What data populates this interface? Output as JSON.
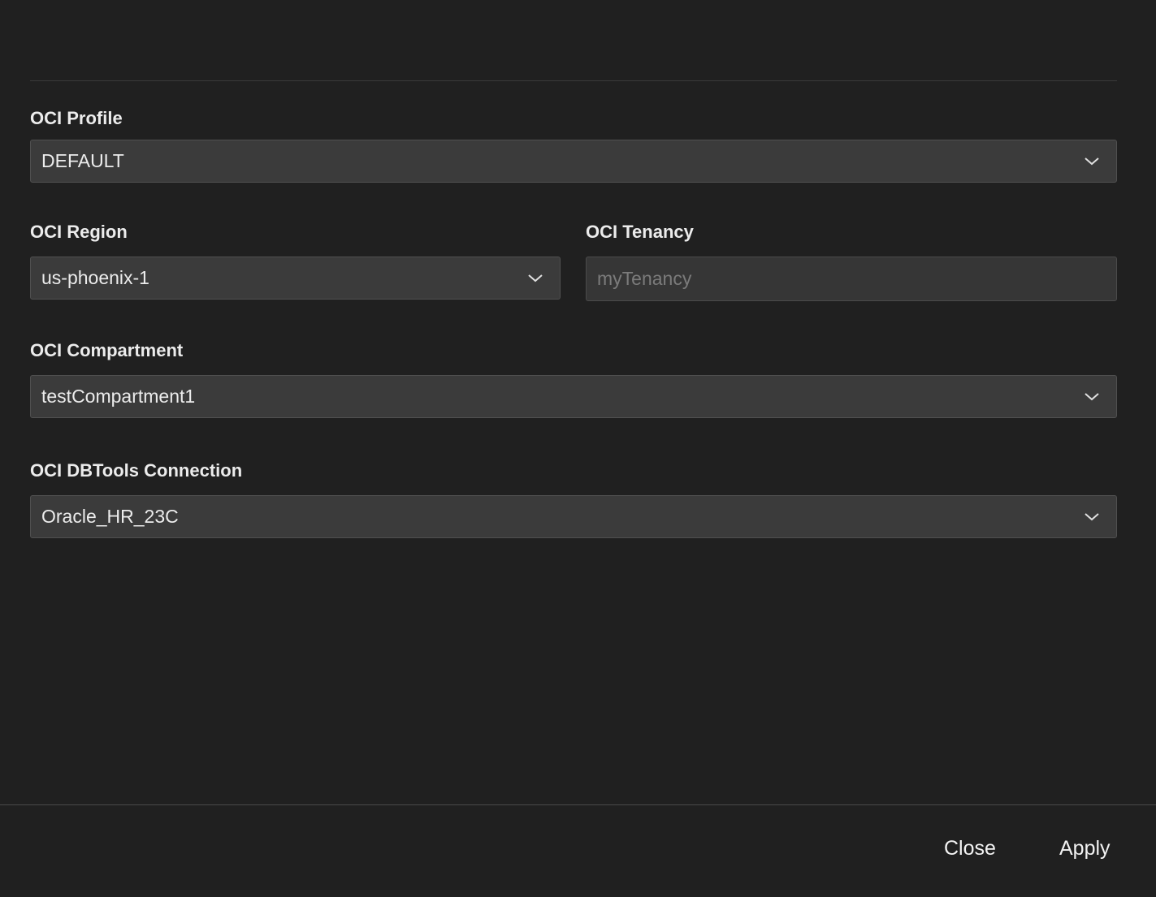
{
  "form": {
    "profile": {
      "label": "OCI Profile",
      "value": "DEFAULT"
    },
    "region": {
      "label": "OCI Region",
      "value": "us-phoenix-1"
    },
    "tenancy": {
      "label": "OCI Tenancy",
      "value": "",
      "placeholder": "myTenancy"
    },
    "compartment": {
      "label": "OCI Compartment",
      "value": "testCompartment1"
    },
    "connection": {
      "label": "OCI DBTools Connection",
      "value": "Oracle_HR_23C"
    }
  },
  "footer": {
    "close_label": "Close",
    "apply_label": "Apply"
  },
  "icons": {
    "dropdown": "chevron-down-icon"
  },
  "colors": {
    "background": "#202020",
    "field_background": "#3b3b3b",
    "text": "#ececec",
    "placeholder": "#7b7b7b"
  }
}
